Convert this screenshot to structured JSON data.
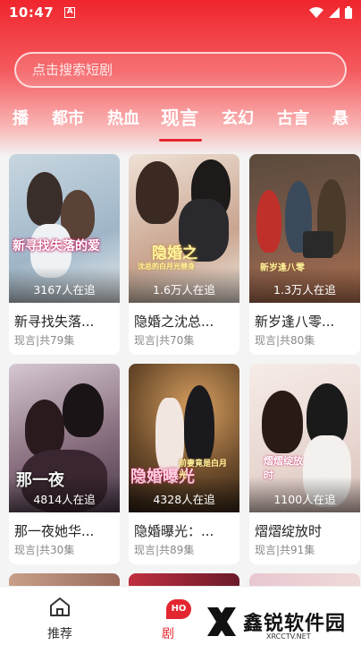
{
  "status": {
    "time": "10:47",
    "a_badge": "A"
  },
  "search": {
    "placeholder": "点击搜索短剧"
  },
  "tabs": [
    {
      "label": "播"
    },
    {
      "label": "都市"
    },
    {
      "label": "热血"
    },
    {
      "label": "现言",
      "active": true
    },
    {
      "label": "玄幻"
    },
    {
      "label": "古言"
    },
    {
      "label": "悬"
    }
  ],
  "cards": [
    {
      "title": "新寻找失落...",
      "sub": "现言|共79集",
      "count": "3167人在追",
      "art": "新寻找失落的爱",
      "palette": [
        "#9fb6c8",
        "#e8ecef"
      ]
    },
    {
      "title": "隐婚之沈总...",
      "sub": "现言|共70集",
      "count": "1.6万人在追",
      "art": "隐婚之",
      "art2": "沈总的白月光替身",
      "palette": [
        "#c9a590",
        "#efe1d6"
      ]
    },
    {
      "title": "新岁逢八零...",
      "sub": "现言|共80集",
      "count": "1.3万人在追",
      "art": "新岁逢八零",
      "palette": [
        "#7a5a4a",
        "#c98a6a"
      ]
    },
    {
      "title": "那一夜她华...",
      "sub": "现言|共30集",
      "count": "4814人在追",
      "art": "那一夜",
      "palette": [
        "#4a3a4a",
        "#b7a0b0"
      ]
    },
    {
      "title": "隐婚曝光：...",
      "sub": "现言|共89集",
      "count": "4328人在追",
      "art": "隐婚曝光",
      "art2": "前妻竟是白月光",
      "palette": [
        "#3a2a1c",
        "#d9a060"
      ]
    },
    {
      "title": "熠熠绽放时",
      "sub": "现言|共91集",
      "count": "1100人在追",
      "art": "熠熠绽放时",
      "palette": [
        "#e8d6d0",
        "#f6ece8"
      ]
    }
  ],
  "bottom_nav": {
    "home_label": "推荐",
    "drama_label": "剧",
    "drama_badge": "HO"
  },
  "watermark": {
    "brand": "鑫锐软件园",
    "domain": "XRCCTV.NET"
  },
  "colors": {
    "accent": "#e3262f"
  }
}
